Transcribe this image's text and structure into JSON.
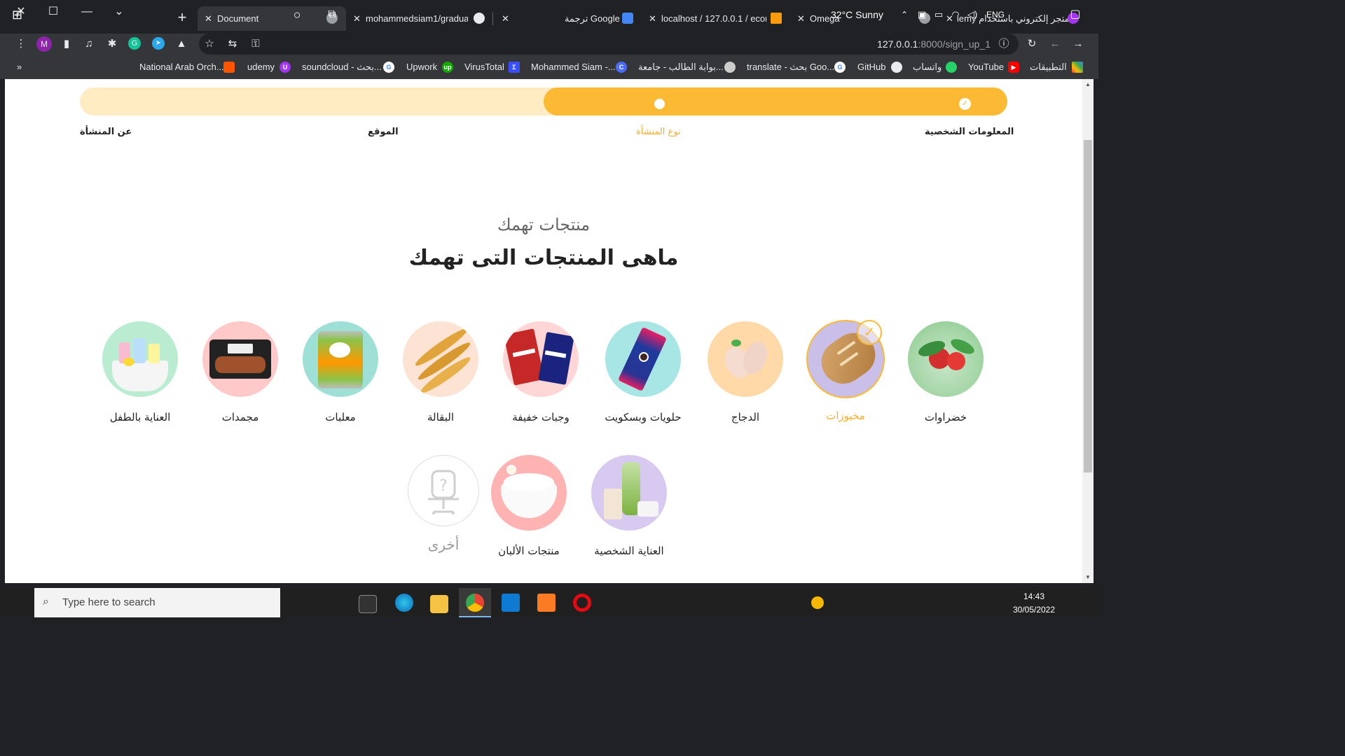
{
  "browser": {
    "tabs": [
      {
        "title": "متجر إلكتروني باستخدام lemy",
        "icon": "udemy-icon"
      },
      {
        "title": "Omega",
        "icon": "globe-icon"
      },
      {
        "title": "localhost / 127.0.0.1 / econ",
        "icon": "phpmyadmin-icon"
      },
      {
        "title": "ترجمة Google",
        "icon": "google-translate-icon"
      },
      {
        "title": "mohammedsiam1/graduat",
        "icon": "github-icon"
      },
      {
        "title": "Document",
        "icon": "globe-icon",
        "active": true
      }
    ],
    "url_host": "127.0.0.1",
    "url_path": ":8000/sign_up_1",
    "profile_initial": "M",
    "bookmarks": [
      {
        "label": "التطبيقات",
        "icon": "apps-grid-icon"
      },
      {
        "label": "YouTube",
        "icon": "youtube-icon"
      },
      {
        "label": "واتساب",
        "icon": "whatsapp-icon"
      },
      {
        "label": "GitHub",
        "icon": "github-icon"
      },
      {
        "label": "translate - بحث Goo...",
        "icon": "google-icon"
      },
      {
        "label": "بوابة الطالب - جامعة...",
        "icon": "university-icon"
      },
      {
        "label": "Mohammed Siam -...",
        "icon": "c-icon"
      },
      {
        "label": "VirusTotal",
        "icon": "virustotal-icon"
      },
      {
        "label": "Upwork",
        "icon": "upwork-icon"
      },
      {
        "label": "soundcloud - بحث...",
        "icon": "google-icon"
      },
      {
        "label": "udemy",
        "icon": "udemy-icon"
      },
      {
        "label": "National Arab Orch...",
        "icon": "soundcloud-icon"
      }
    ],
    "more_bookmarks": "»"
  },
  "steps": [
    {
      "label": "المعلومات الشخصية",
      "state": "done"
    },
    {
      "label": "نوع المنشأة",
      "state": "current"
    },
    {
      "label": "الموقع",
      "state": "pending"
    },
    {
      "label": "عن المنشأة",
      "state": "pending"
    }
  ],
  "progress_fraction": 0.5,
  "section": {
    "subtitle": "منتجات تهمك",
    "title": "ماهى المنتجات التى تهمك"
  },
  "categories": [
    {
      "label": "خضراوات",
      "selected": false
    },
    {
      "label": "مخبوزات",
      "selected": true
    },
    {
      "label": "الدجاج",
      "selected": false
    },
    {
      "label": "حلويات وبسكويت",
      "selected": false
    },
    {
      "label": "وجبات خفيفة",
      "selected": false
    },
    {
      "label": "البقالة",
      "selected": false
    },
    {
      "label": "معلبات",
      "selected": false
    },
    {
      "label": "مجمدات",
      "selected": false
    },
    {
      "label": "العناية بالطفل",
      "selected": false
    },
    {
      "label": "العناية الشخصية",
      "selected": false
    },
    {
      "label": "منتجات الألبان",
      "selected": false
    },
    {
      "label": "أخرى",
      "selected": false
    }
  ],
  "taskbar": {
    "search_placeholder": "Type here to search",
    "weather": "32°C  Sunny",
    "language": "ENG",
    "time": "14:43",
    "date": "30/05/2022"
  },
  "colors": {
    "accent": "#fbb934",
    "accent_light": "#ffecc2"
  }
}
